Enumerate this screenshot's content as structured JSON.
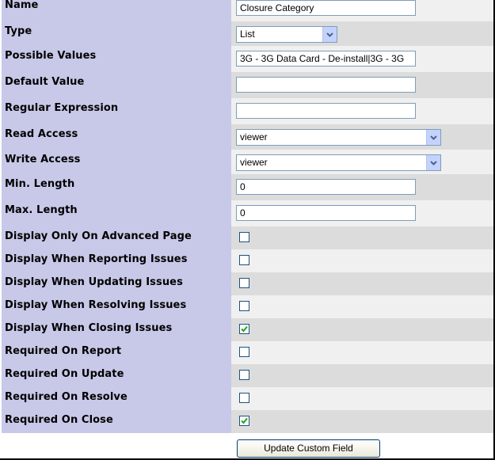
{
  "fields": {
    "name": {
      "label": "Name",
      "value": "Closure Category"
    },
    "type": {
      "label": "Type",
      "value": "List"
    },
    "possible_values": {
      "label": "Possible Values",
      "value": "3G - 3G Data Card - De-install|3G - 3G"
    },
    "default_value": {
      "label": "Default Value",
      "value": ""
    },
    "regular_expression": {
      "label": "Regular Expression",
      "value": ""
    },
    "read_access": {
      "label": "Read Access",
      "value": "viewer"
    },
    "write_access": {
      "label": "Write Access",
      "value": "viewer"
    },
    "min_length": {
      "label": "Min. Length",
      "value": "0"
    },
    "max_length": {
      "label": "Max. Length",
      "value": "0"
    }
  },
  "flags": [
    {
      "label": "Display Only On Advanced Page",
      "checked": false
    },
    {
      "label": "Display When Reporting Issues",
      "checked": false
    },
    {
      "label": "Display When Updating Issues",
      "checked": false
    },
    {
      "label": "Display When Resolving Issues",
      "checked": false
    },
    {
      "label": "Display When Closing Issues",
      "checked": true
    },
    {
      "label": "Required On Report",
      "checked": false
    },
    {
      "label": "Required On Update",
      "checked": false
    },
    {
      "label": "Required On Resolve",
      "checked": false
    },
    {
      "label": "Required On Close",
      "checked": true
    }
  ],
  "submit": {
    "label": "Update Custom Field"
  },
  "icons": {
    "dropdown": "chevron-down-icon",
    "check": "checkmark-icon"
  },
  "colors": {
    "label_bg": "#c8c8e8",
    "row_light": "#f0f0f0",
    "row_dark": "#dcdcdc",
    "check": "#21a121"
  }
}
